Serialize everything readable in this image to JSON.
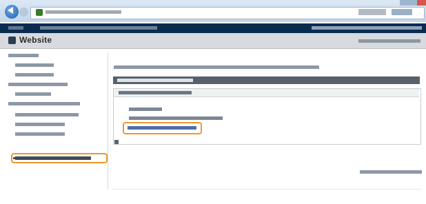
{
  "app": {
    "title": "Website"
  },
  "colors": {
    "header_navy": "#0a2c4f",
    "highlight_orange": "#f0972a",
    "section_header_gray": "#58606b"
  },
  "icons": [
    "back-icon",
    "forward-icon",
    "favicon-icon",
    "app-icon"
  ],
  "sidebar": {
    "item_count": 12,
    "active_index": 11
  }
}
